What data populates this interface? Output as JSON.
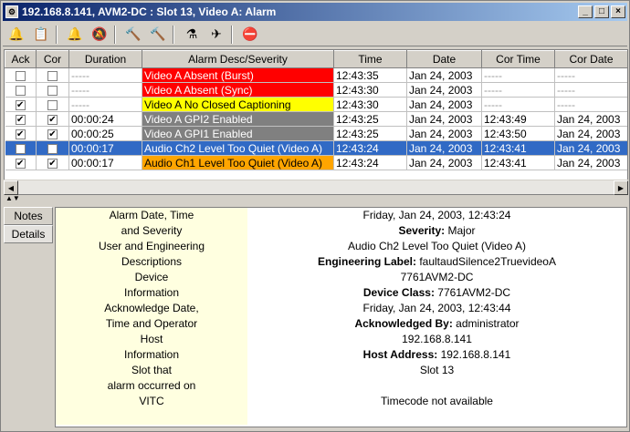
{
  "window": {
    "title": "192.168.8.141, AVM2-DC : Slot 13, Video A: Alarm",
    "minimize": "_",
    "maximize": "□",
    "close": "×"
  },
  "columns": [
    "Ack",
    "Cor",
    "Duration",
    "Alarm Desc/Severity",
    "Time",
    "Date",
    "Cor Time",
    "Cor Date"
  ],
  "rows": [
    {
      "ack": false,
      "cor": false,
      "duration": "-----",
      "desc": "Video A Absent (Burst)",
      "color": "#ff0000",
      "text_color": "#ffffff",
      "time": "12:43:35",
      "date": "Jan 24, 2003",
      "cor_time": "-----",
      "cor_date": "-----",
      "selected": false
    },
    {
      "ack": false,
      "cor": false,
      "duration": "-----",
      "desc": "Video A Absent (Sync)",
      "color": "#ff0000",
      "text_color": "#ffffff",
      "time": "12:43:30",
      "date": "Jan 24, 2003",
      "cor_time": "-----",
      "cor_date": "-----",
      "selected": false
    },
    {
      "ack": true,
      "cor": false,
      "duration": "-----",
      "desc": "Video A No Closed Captioning",
      "color": "#ffff00",
      "text_color": "#000000",
      "time": "12:43:30",
      "date": "Jan 24, 2003",
      "cor_time": "-----",
      "cor_date": "-----",
      "selected": false
    },
    {
      "ack": true,
      "cor": true,
      "duration": "00:00:24",
      "desc": "Video A GPI2 Enabled",
      "color": "#808080",
      "text_color": "#ffffff",
      "time": "12:43:25",
      "date": "Jan 24, 2003",
      "cor_time": "12:43:49",
      "cor_date": "Jan 24, 2003",
      "selected": false
    },
    {
      "ack": true,
      "cor": true,
      "duration": "00:00:25",
      "desc": "Video A GPI1 Enabled",
      "color": "#808080",
      "text_color": "#ffffff",
      "time": "12:43:25",
      "date": "Jan 24, 2003",
      "cor_time": "12:43:50",
      "cor_date": "Jan 24, 2003",
      "selected": false
    },
    {
      "ack": true,
      "cor": true,
      "duration": "00:00:17",
      "desc": "Audio Ch2 Level Too Quiet (Video A)",
      "color": "#316ac5",
      "text_color": "#ffffff",
      "time": "12:43:24",
      "date": "Jan 24, 2003",
      "cor_time": "12:43:41",
      "cor_date": "Jan 24, 2003",
      "selected": true
    },
    {
      "ack": true,
      "cor": true,
      "duration": "00:00:17",
      "desc": "Audio Ch1 Level Too Quiet (Video A)",
      "color": "#ffa500",
      "text_color": "#000000",
      "time": "12:43:24",
      "date": "Jan 24, 2003",
      "cor_time": "12:43:41",
      "cor_date": "Jan 24, 2003",
      "selected": false
    }
  ],
  "tabs": {
    "notes": "Notes",
    "details": "Details"
  },
  "details": [
    {
      "label1": "Alarm Date, Time",
      "label2": "and Severity",
      "value1": "Friday, Jan 24, 2003, 12:43:24",
      "bold_key": "Severity:",
      "bold_val": " Major"
    },
    {
      "label1": "User and Engineering",
      "label2": "Descriptions",
      "value1": "Audio Ch2 Level Too Quiet (Video A)",
      "bold_key": "Engineering Label:",
      "bold_val": " faultaudSilence2TruevideoA"
    },
    {
      "label1": "Device",
      "label2": "Information",
      "value1": "7761AVM2-DC",
      "bold_key": "Device Class:",
      "bold_val": " 7761AVM2-DC"
    },
    {
      "label1": "Acknowledge Date,",
      "label2": "Time and Operator",
      "value1": "Friday, Jan 24, 2003, 12:43:44",
      "bold_key": "Acknowledged By:",
      "bold_val": " administrator"
    },
    {
      "label1": "Host",
      "label2": "Information",
      "value1": "192.168.8.141",
      "bold_key": "Host Address:",
      "bold_val": " 192.168.8.141"
    },
    {
      "label1": "Slot that",
      "label2": "alarm occurred on",
      "value1": "Slot 13",
      "bold_key": "",
      "bold_val": ""
    },
    {
      "label1": "VITC",
      "label2": "",
      "value1": "Timecode not available",
      "bold_key": "",
      "bold_val": ""
    }
  ]
}
